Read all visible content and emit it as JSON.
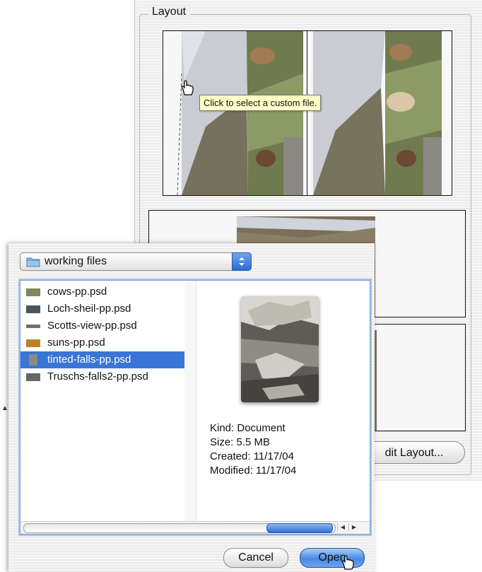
{
  "layout_panel": {
    "legend": "Layout",
    "tooltip": "Click to select a custom file.",
    "edit_layout_button": "dit Layout..."
  },
  "dialog": {
    "location": "working files",
    "files": [
      {
        "name": "cows-pp.psd",
        "thumb_color": "#7a8a5c",
        "selected": false
      },
      {
        "name": "Loch-sheil-pp.psd",
        "thumb_color": "#4b5560",
        "selected": false
      },
      {
        "name": "Scotts-view-pp.psd",
        "thumb_color": "#6f7560",
        "selected": false
      },
      {
        "name": "suns-pp.psd",
        "thumb_color": "#c0802a",
        "selected": false
      },
      {
        "name": "tinted-falls-pp.psd",
        "thumb_color": "#8d8a80",
        "selected": true
      },
      {
        "name": "Truschs-falls2-pp.psd",
        "thumb_color": "#666666",
        "selected": false
      }
    ],
    "preview": {
      "kind": "Kind: Document",
      "size": "Size: 5.5 MB",
      "created": "Created: 11/17/04",
      "modified": "Modified: 11/17/04"
    },
    "buttons": {
      "cancel": "Cancel",
      "open": "Open"
    }
  },
  "colors": {
    "selection": "#3875d7",
    "default_button": "#4a8ae4",
    "tooltip_bg": "#ffffc7"
  }
}
